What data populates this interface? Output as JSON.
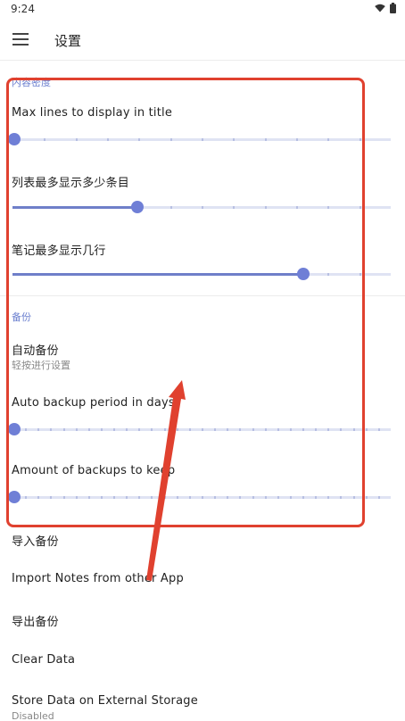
{
  "status_bar": {
    "time": "9:24"
  },
  "app_bar": {
    "title": "设置"
  },
  "sections": {
    "content": {
      "header": "内容密度",
      "max_lines_title": {
        "label": "Max lines to display in title",
        "value": 0.0
      },
      "list_items": {
        "label": "列表最多显示多少条目",
        "value": 0.33
      },
      "note_lines": {
        "label": "笔记最多显示几行",
        "value": 0.77
      }
    },
    "backup": {
      "header": "备份",
      "auto_backup": {
        "label": "自动备份",
        "summary": "轻按进行设置"
      },
      "period": {
        "label": "Auto backup period in days",
        "value": 0.0
      },
      "amount": {
        "label": "Amount of backups to keep",
        "value": 0.0
      },
      "import_backup": {
        "label": "导入备份"
      },
      "import_other": {
        "label": "Import Notes from other App"
      },
      "export_backup": {
        "label": "导出备份"
      },
      "clear_data": {
        "label": "Clear Data"
      },
      "external_storage": {
        "label": "Store Data on External Storage",
        "summary": "Disabled"
      }
    }
  },
  "colors": {
    "accent": "#6f7fd6",
    "annotation": "#e0412f"
  }
}
